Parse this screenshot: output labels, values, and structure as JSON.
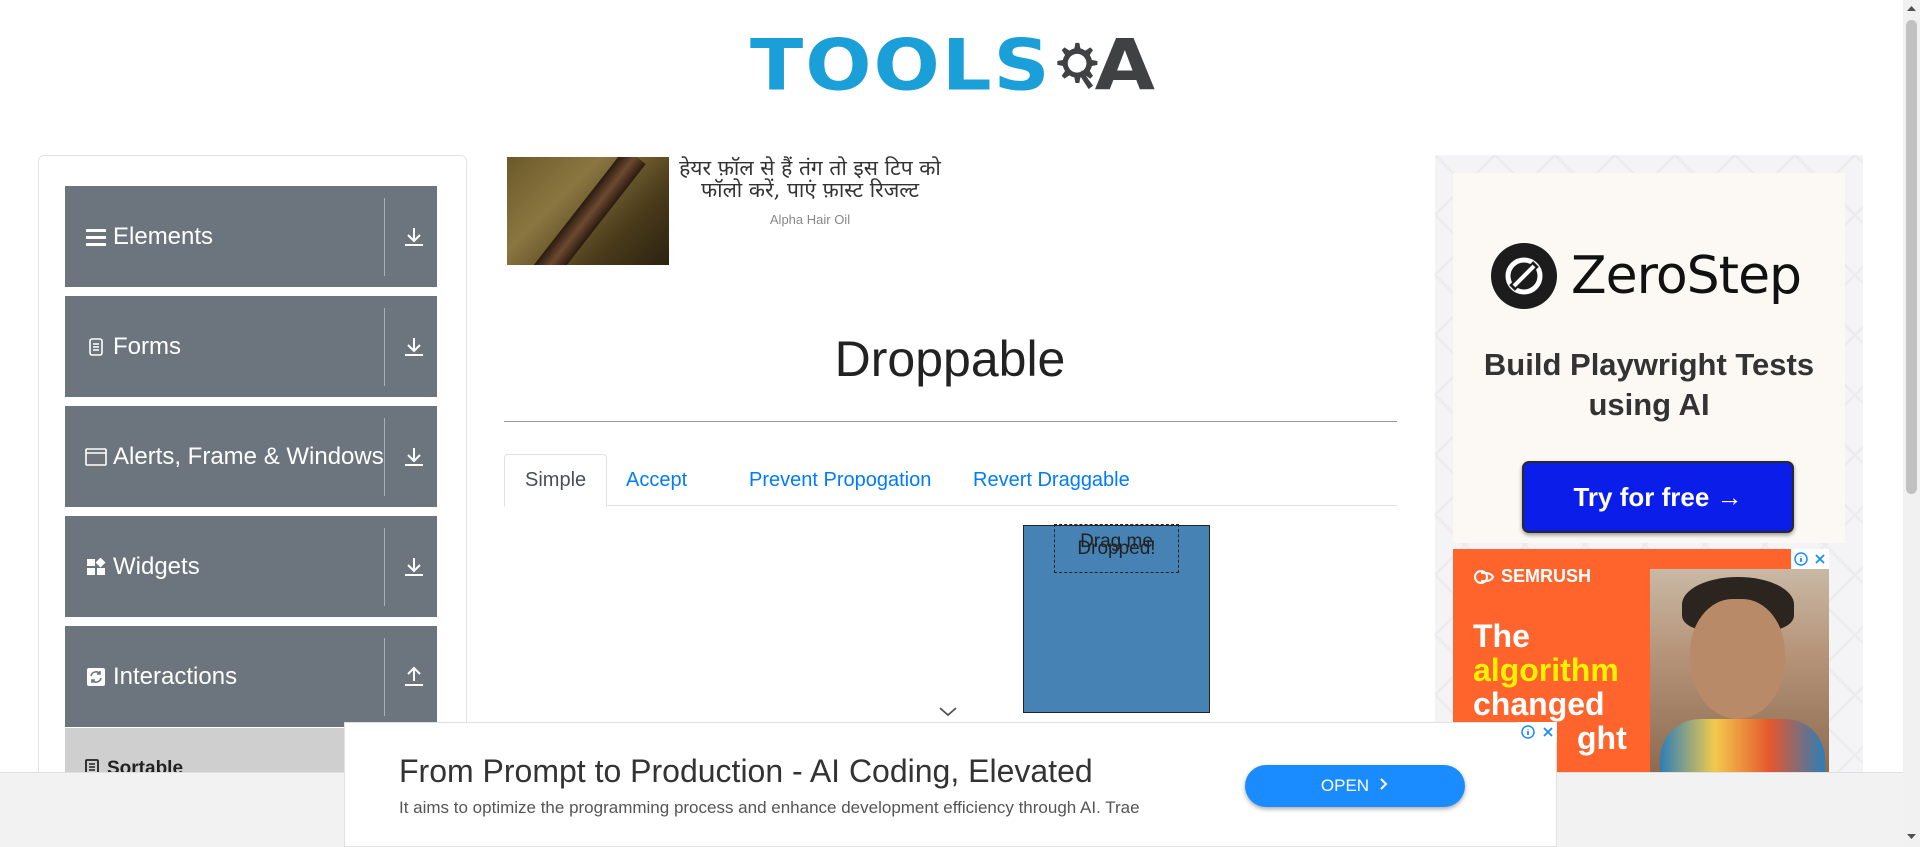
{
  "header": {
    "logo_text": "TOOLS",
    "logo_suffix": "A"
  },
  "sidebar": {
    "groups": [
      {
        "label": "Elements",
        "icon": "list-icon",
        "toggle": "download-icon"
      },
      {
        "label": "Forms",
        "icon": "document-icon",
        "toggle": "download-icon"
      },
      {
        "label": "Alerts, Frame & Windows",
        "icon": "window-icon",
        "toggle": "download-icon"
      },
      {
        "label": "Widgets",
        "icon": "widgets-icon",
        "toggle": "download-icon"
      },
      {
        "label": "Interactions",
        "icon": "interactions-icon",
        "toggle": "upload-icon"
      }
    ],
    "sub_item": "Sortable"
  },
  "top_ad": {
    "headline": "हेयर फ़ॉल से हैं तंग तो इस टिप को फॉलो करें, पाएं फ़ास्ट रिजल्ट",
    "source": "Alpha Hair Oil"
  },
  "main": {
    "title": "Droppable",
    "tabs": [
      {
        "label": "Simple",
        "active": true
      },
      {
        "label": "Accept",
        "active": false
      },
      {
        "label": "Prevent Propogation",
        "active": false
      },
      {
        "label": "Revert Draggable",
        "active": false
      }
    ],
    "drop_text": "Dropped!",
    "drag_text": "Drag me",
    "drop_color": "#4682b4"
  },
  "right_ad": {
    "brand": "ZeroStep",
    "tagline": "Build Playwright Tests using AI",
    "cta": "Try for free →",
    "cta_color": "#0b1de8",
    "semrush": {
      "brand": "SEMRUSH",
      "line1": "The",
      "line2": "algorithm",
      "line3": "changed",
      "line4": "ght"
    }
  },
  "bottom_ad": {
    "title": "From Prompt to Production - AI Coding, Elevated",
    "description": "It aims to optimize the programming process and enhance development efficiency through AI. Trae",
    "button": "OPEN"
  }
}
